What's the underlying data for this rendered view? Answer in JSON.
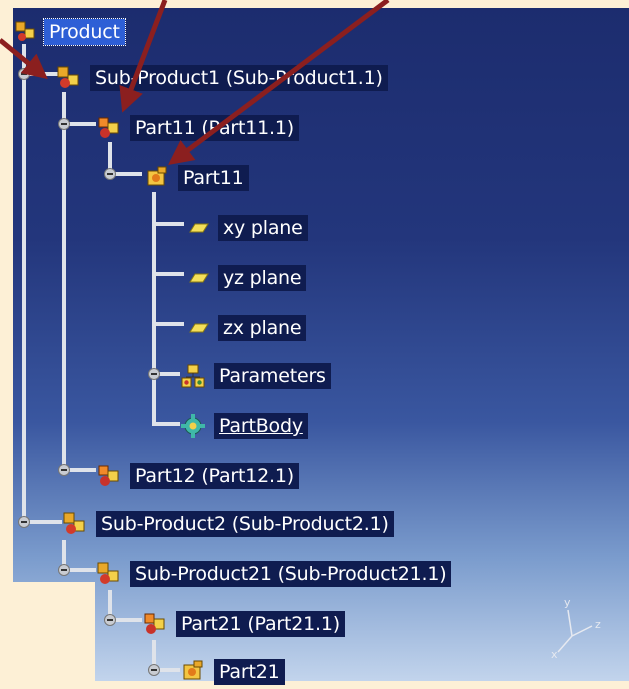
{
  "tree": {
    "root": {
      "label": "Product",
      "icon": "product-icon"
    },
    "nodes": [
      {
        "id": "sub-product1",
        "label": "Sub-Product1 (Sub-Product1.1)",
        "icon": "product-icon"
      },
      {
        "id": "part11",
        "label": "Part11 (Part11.1)",
        "icon": "component-icon"
      },
      {
        "id": "part11-part",
        "label": "Part11",
        "icon": "part-icon"
      },
      {
        "id": "xy-plane",
        "label": "xy plane",
        "icon": "plane-icon"
      },
      {
        "id": "yz-plane",
        "label": "yz plane",
        "icon": "plane-icon"
      },
      {
        "id": "zx-plane",
        "label": "zx plane",
        "icon": "plane-icon"
      },
      {
        "id": "parameters",
        "label": "Parameters",
        "icon": "parameters-icon"
      },
      {
        "id": "partbody",
        "label": "PartBody",
        "icon": "partbody-icon"
      },
      {
        "id": "part12",
        "label": "Part12 (Part12.1)",
        "icon": "component-icon"
      },
      {
        "id": "sub-product2",
        "label": "Sub-Product2 (Sub-Product2.1)",
        "icon": "product-icon"
      },
      {
        "id": "sub-product21",
        "label": "Sub-Product21 (Sub-Product21.1)",
        "icon": "product-icon"
      },
      {
        "id": "part21",
        "label": "Part21 (Part21.1)",
        "icon": "component-icon"
      },
      {
        "id": "part21-part",
        "label": "Part21",
        "icon": "part-icon"
      }
    ]
  },
  "axis": {
    "x": "x",
    "y": "y",
    "z": "z"
  },
  "colors": {
    "background_top": "#1c2c6e",
    "background_bottom": "#c2d4ec",
    "page_beige": "#fdf0d6",
    "arrow": "#8b1f1f",
    "selection": "#2e5fd6"
  }
}
